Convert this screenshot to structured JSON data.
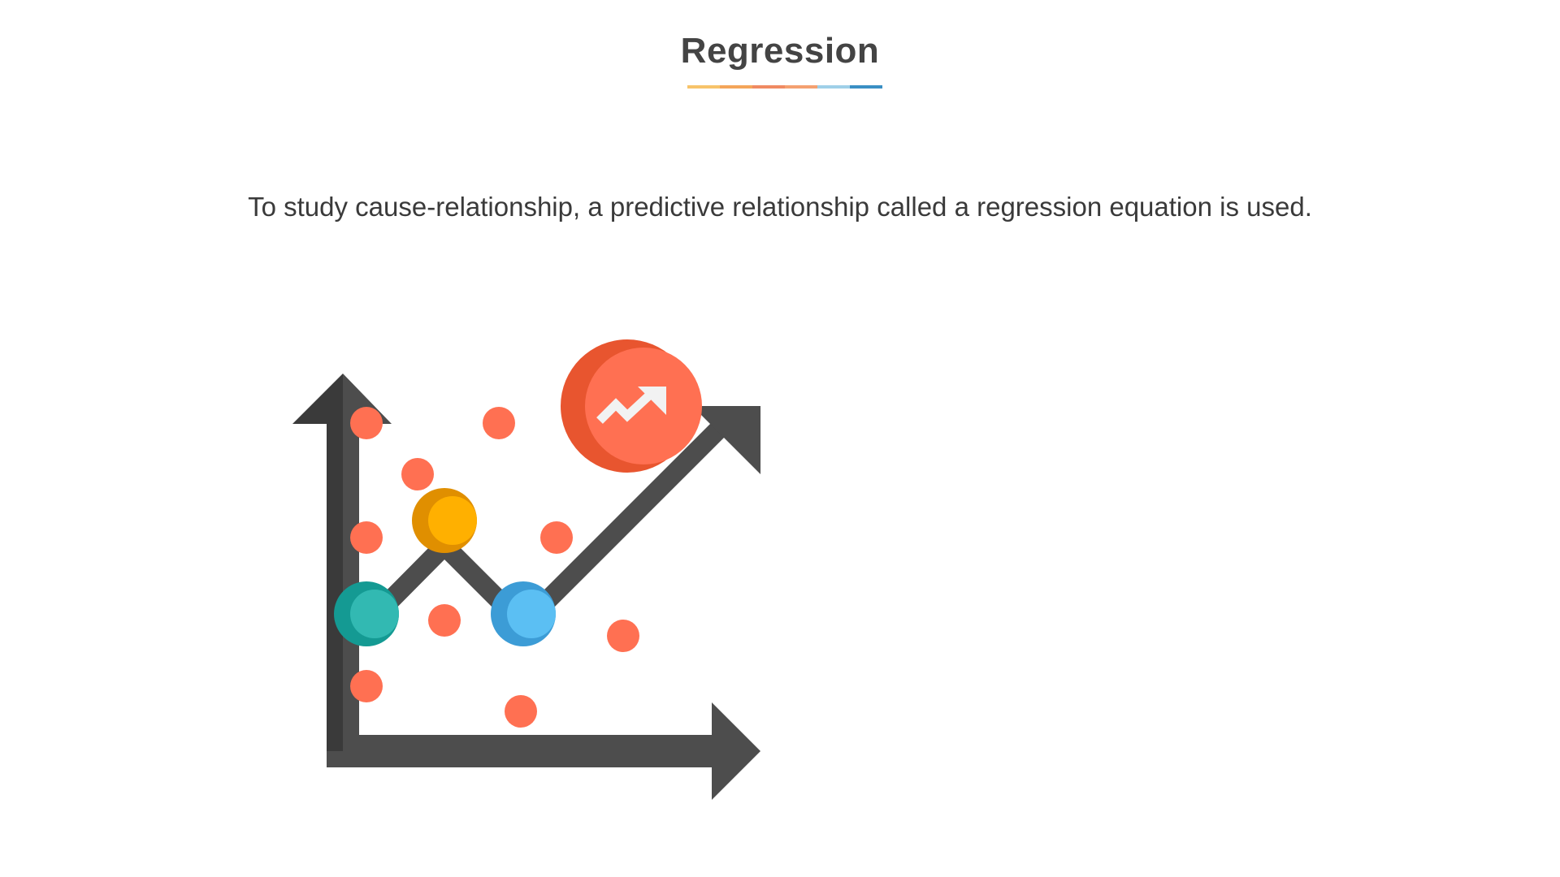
{
  "slide": {
    "title": "Regression",
    "description": "To study cause-relationship, a predictive relationship called a regression equation is used.",
    "underline_colors": [
      "#f7c36a",
      "#f4a55a",
      "#f08a62",
      "#f4a070",
      "#9fd0e8",
      "#3a8fc4"
    ]
  },
  "illustration": {
    "icon": "regression-chart-icon",
    "badge_icon": "trending-up-icon",
    "colors": {
      "axes": "#4d4d4d",
      "axes_shadow": "#3a3a3a",
      "scatter_points": "#ff7052",
      "badge": "#ff7052",
      "badge_shadow": "#e8552f",
      "node_teal": "#32b9b2",
      "node_teal_shadow": "#149a93",
      "node_yellow": "#ffb000",
      "node_yellow_shadow": "#e08f00",
      "node_blue": "#5bbff3",
      "node_blue_shadow": "#3c9cd6",
      "badge_arrow": "#f2f2f2"
    }
  }
}
